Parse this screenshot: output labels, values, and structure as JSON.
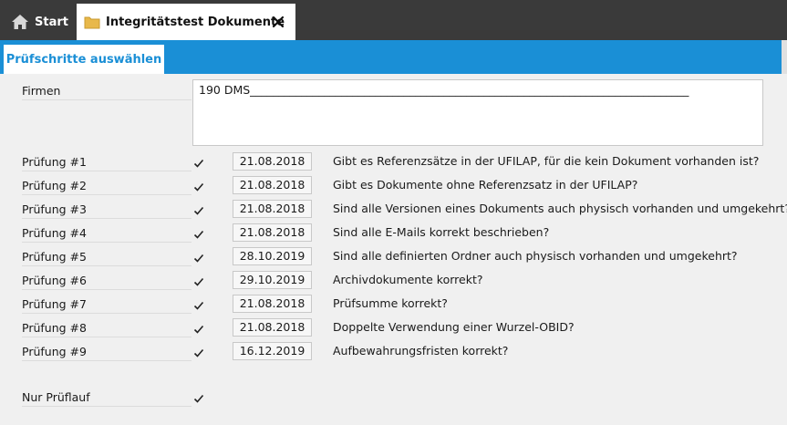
{
  "tabs": {
    "start_label": "Start",
    "doc_label": "Integritätstest Dokumente"
  },
  "subtab": {
    "label": "Prüfschritte auswählen"
  },
  "firmen": {
    "label": "Firmen",
    "value": "190 DMS_____________________________________________________________________________"
  },
  "checks": [
    {
      "label": "Prüfung #1",
      "checked": true,
      "date": "21.08.2018",
      "question": "Gibt es Referenzsätze in der UFILAP, für die kein Dokument vorhanden ist?"
    },
    {
      "label": "Prüfung #2",
      "checked": true,
      "date": "21.08.2018",
      "question": "Gibt es Dokumente ohne Referenzsatz in der UFILAP?"
    },
    {
      "label": "Prüfung #3",
      "checked": true,
      "date": "21.08.2018",
      "question": "Sind alle Versionen eines Dokuments auch physisch vorhanden und umgekehrt?"
    },
    {
      "label": "Prüfung #4",
      "checked": true,
      "date": "21.08.2018",
      "question": "Sind alle E-Mails korrekt beschrieben?"
    },
    {
      "label": "Prüfung #5",
      "checked": true,
      "date": "28.10.2019",
      "question": "Sind alle definierten Ordner auch physisch vorhanden und umgekehrt?"
    },
    {
      "label": "Prüfung #6",
      "checked": true,
      "date": "29.10.2019",
      "question": "Archivdokumente korrekt?"
    },
    {
      "label": "Prüfung #7",
      "checked": true,
      "date": "21.08.2018",
      "question": "Prüfsumme korrekt?"
    },
    {
      "label": "Prüfung #8",
      "checked": true,
      "date": "21.08.2018",
      "question": "Doppelte Verwendung einer Wurzel-OBID?"
    },
    {
      "label": "Prüfung #9",
      "checked": true,
      "date": "16.12.2019",
      "question": "Aufbewahrungsfristen korrekt?"
    }
  ],
  "pruflauf": {
    "label": "Nur Prüflauf",
    "checked": true
  },
  "colors": {
    "accent": "#1a8fd6",
    "tabbar": "#3a3a3a",
    "folder": "#e8b84a"
  }
}
